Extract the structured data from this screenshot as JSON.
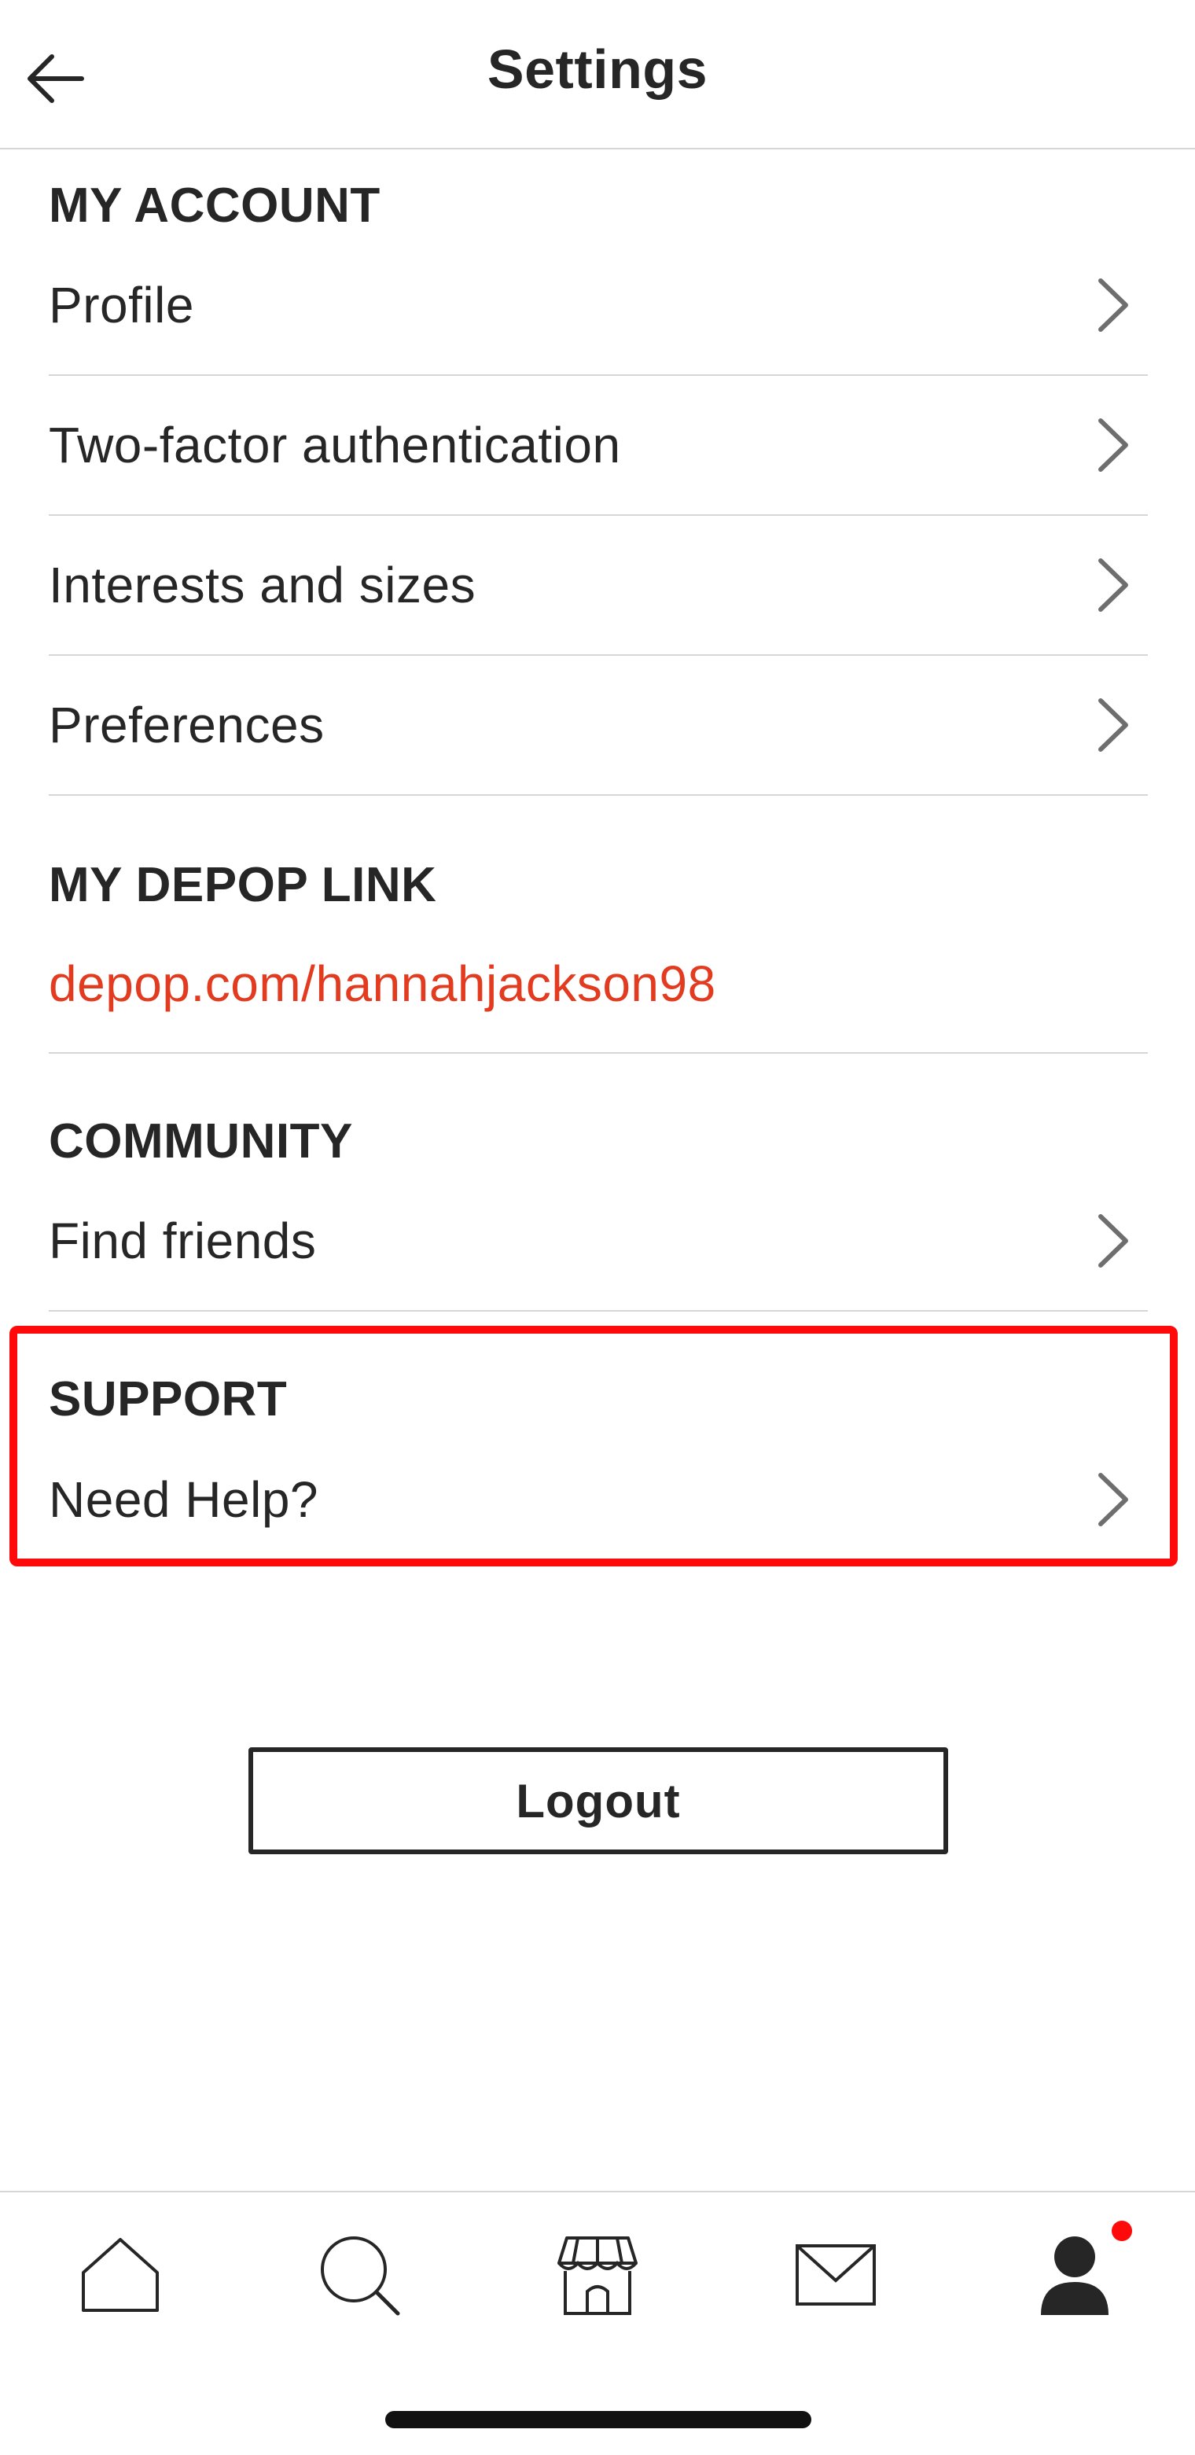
{
  "header": {
    "title": "Settings",
    "back_icon": "arrow-left-icon"
  },
  "sections": {
    "my_account": {
      "heading": "MY ACCOUNT",
      "items": [
        {
          "label": "Profile"
        },
        {
          "label": "Two-factor authentication"
        },
        {
          "label": "Interests and sizes"
        },
        {
          "label": "Preferences"
        }
      ]
    },
    "my_depop_link": {
      "heading": "MY DEPOP LINK",
      "link": "depop.com/hannahjackson98"
    },
    "community": {
      "heading": "COMMUNITY",
      "items": [
        {
          "label": "Find friends"
        }
      ]
    },
    "support": {
      "heading": "SUPPORT",
      "items": [
        {
          "label": "Need Help?"
        }
      ]
    }
  },
  "logout_label": "Logout",
  "bottom_nav": {
    "items": [
      "home-icon",
      "search-icon",
      "shop-icon",
      "messages-icon",
      "profile-icon"
    ],
    "notification_dot_color": "#ff0a0a"
  },
  "colors": {
    "text": "#262626",
    "link": "#e33b1f",
    "divider": "#d6d6d6",
    "highlight": "#ff0a0a"
  }
}
